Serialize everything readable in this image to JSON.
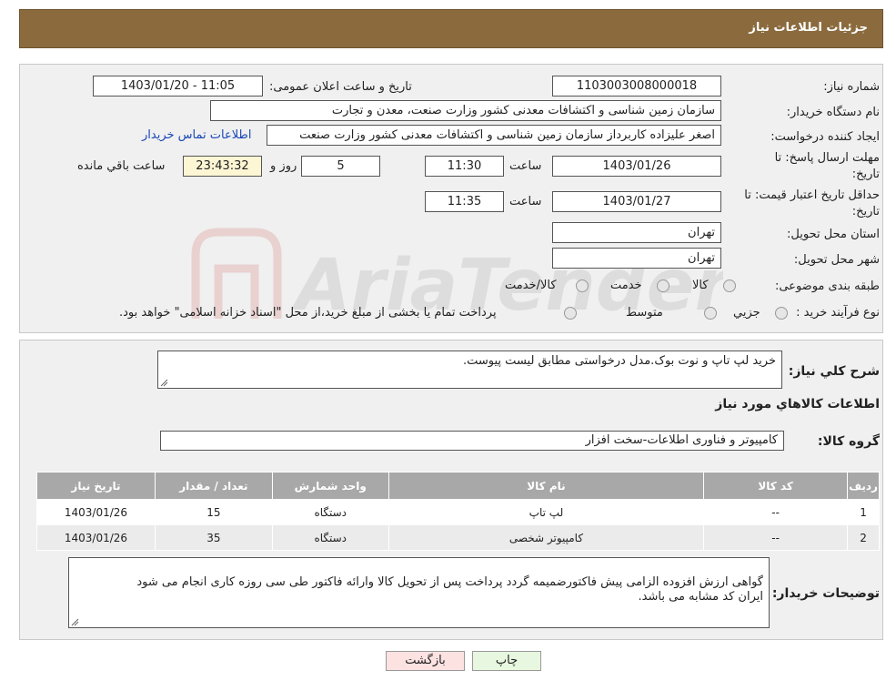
{
  "header": {
    "title": "جزئیات اطلاعات نیاز"
  },
  "form": {
    "need_number_label": "شماره نیاز:",
    "need_number": "1103003008000018",
    "announce_label": "تاریخ و ساعت اعلان عمومی:",
    "announce_value": "1403/01/20 - 11:05",
    "buyer_org_label": "نام دستگاه خریدار:",
    "buyer_org": "سازمان زمین شناسی و اکتشافات معدنی کشور وزارت صنعت، معدن و تجارت",
    "creator_label": "ایجاد کننده درخواست:",
    "creator": "اصغر علیزاده کاربرداز سازمان زمین شناسی و اکتشافات معدنی کشور وزارت صنعت",
    "contact_link": "اطلاعات تماس خریدار",
    "deadline_label_1": "مهلت ارسال پاسخ: تا",
    "deadline_label_2": "تاریخ:",
    "deadline_date": "1403/01/26",
    "time_label": "ساعت",
    "deadline_time": "11:30",
    "days_value": "5",
    "days_label": "روز و",
    "remaining_time": "23:43:32",
    "remaining_label": "ساعت باقي مانده",
    "validity_label_1": "حداقل تاریخ اعتبار قیمت: تا",
    "validity_label_2": "تاریخ:",
    "validity_date": "1403/01/27",
    "validity_time": "11:35",
    "province_label": "استان محل تحویل:",
    "province": "تهران",
    "city_label": "شهر محل تحویل:",
    "city": "تهران",
    "category_label": "طبقه بندی موضوعی:",
    "category_options": [
      "کالا",
      "خدمت",
      "کالا/خدمت"
    ],
    "process_label": "نوع فرآیند خرید :",
    "process_options": [
      "جزيي",
      "متوسط"
    ],
    "process_note": "پرداخت تمام یا بخشی از مبلغ خرید،از محل \"اسناد خزانه اسلامی\" خواهد بود."
  },
  "details": {
    "summary_label": "شرح کلي نياز:",
    "summary": "خرید لپ تاپ و نوت بوک.مدل درخواستی مطابق لیست پیوست.",
    "goods_info_title": "اطلاعات کالاهاي مورد نياز",
    "group_label": "گروه کالا:",
    "group": "کامپیوتر و فناوری اطلاعات-سخت افزار",
    "table": {
      "headers": [
        "رديف",
        "کد کالا",
        "نام کالا",
        "واحد شمارش",
        "تعداد / مقدار",
        "تاریخ نیاز"
      ],
      "rows": [
        [
          "1",
          "--",
          "لپ تاپ",
          "دستگاه",
          "15",
          "1403/01/26"
        ],
        [
          "2",
          "--",
          "کامپیوتر شخصی",
          "دستگاه",
          "35",
          "1403/01/26"
        ]
      ]
    },
    "buyer_notes_label": "توضیحات خریدار:",
    "buyer_notes": "گواهی ارزش افزوده الزامی پیش فاکتورضمیمه گردد پرداخت پس از تحویل کالا وارائه فاکتور طی سی روزه کاری انجام می شود\nایران کد مشابه می باشد."
  },
  "buttons": {
    "back": "بازگشت",
    "print": "چاپ"
  },
  "watermark": {
    "text": "AriaTender.neT"
  },
  "colors": {
    "header_bg": "#8b6b3e",
    "link": "#1a47b8",
    "table_header": "#a8a8a8"
  }
}
